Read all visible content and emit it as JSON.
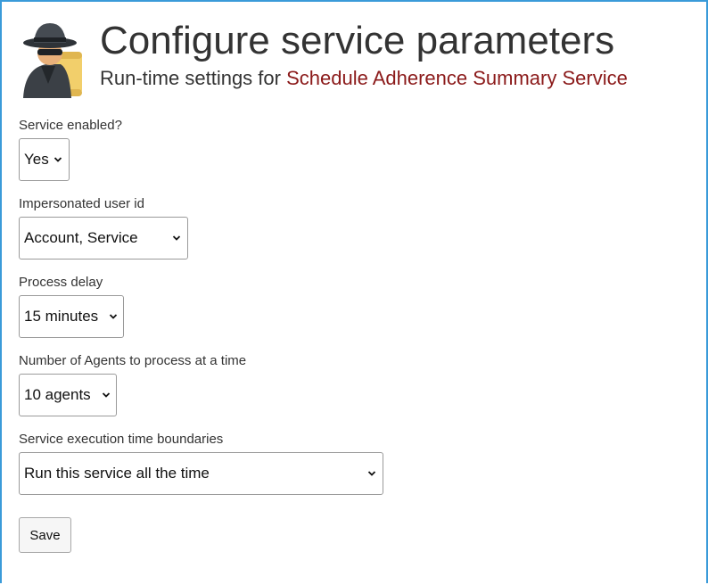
{
  "header": {
    "title": "Configure service parameters",
    "subtitle_prefix": "Run-time settings for ",
    "service_name": "Schedule Adherence Summary Service",
    "logo_icon": "spy-with-scroll-icon"
  },
  "colors": {
    "border_accent": "#3a9bd9",
    "service_name": "#8b1a1a",
    "text": "#333333"
  },
  "fields": {
    "enabled": {
      "label": "Service enabled?",
      "value": "Yes"
    },
    "user": {
      "label": "Impersonated user id",
      "value": "Account, Service"
    },
    "delay": {
      "label": "Process delay",
      "value": "15 minutes"
    },
    "agents": {
      "label": "Number of Agents to process at a time",
      "value": "10 agents"
    },
    "boundaries": {
      "label": "Service execution time boundaries",
      "value": "Run this service all the time"
    }
  },
  "actions": {
    "save_label": "Save"
  }
}
